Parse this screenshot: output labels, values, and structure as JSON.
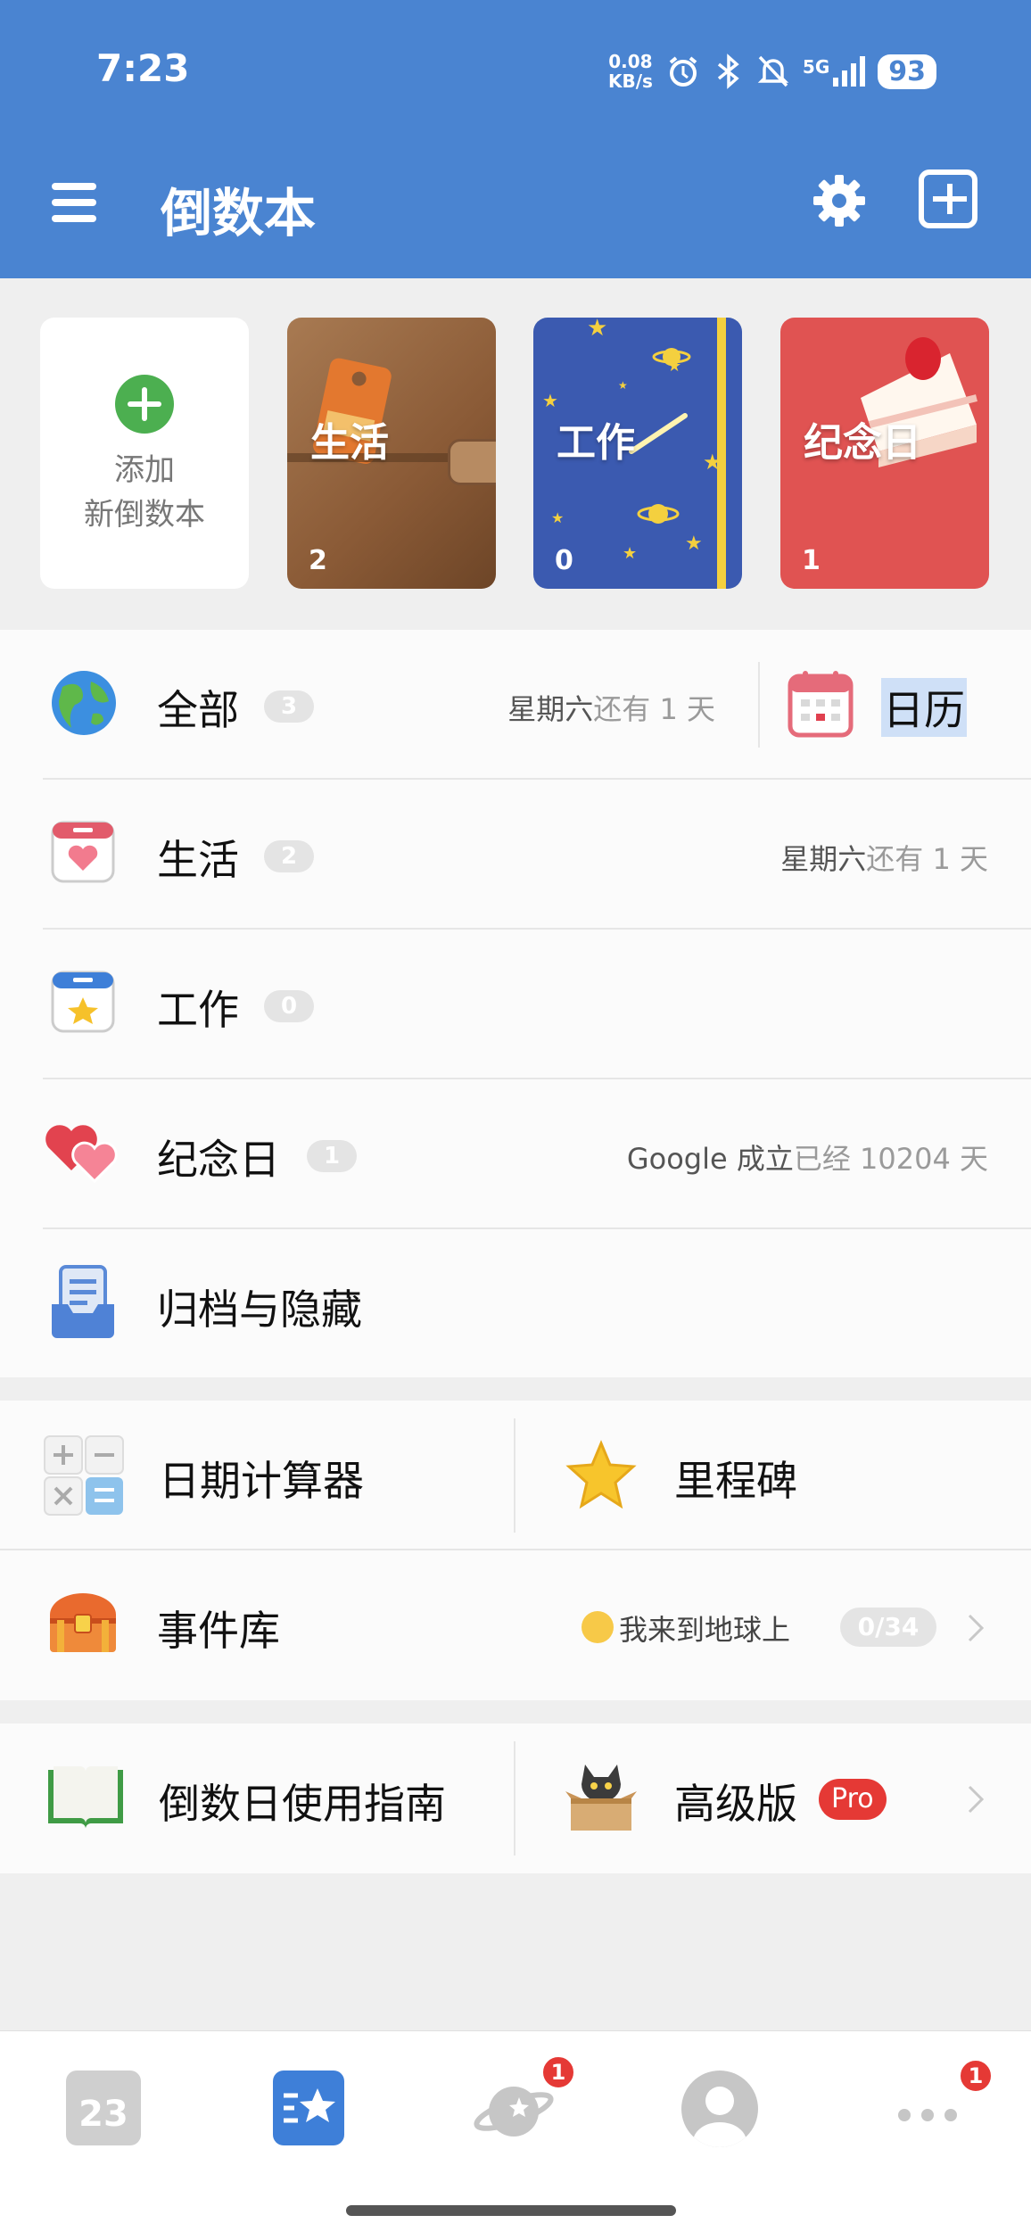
{
  "status_bar": {
    "time": "7:23",
    "net_speed_value": "0.08",
    "net_speed_unit": "KB/s",
    "network": "5G",
    "battery": "93"
  },
  "app_bar": {
    "title": "倒数本"
  },
  "books": {
    "add_line1": "添加",
    "add_line2": "新倒数本",
    "items": [
      {
        "name": "生活",
        "count": "2"
      },
      {
        "name": "工作",
        "count": "0"
      },
      {
        "name": "纪念日",
        "count": "1"
      }
    ]
  },
  "categories": {
    "all": {
      "label": "全部",
      "count": "3",
      "event": "星期六",
      "suffix": "还有 1 天"
    },
    "calendar_label": "日历",
    "life": {
      "label": "生活",
      "count": "2",
      "event": "星期六",
      "suffix": "还有 1 天"
    },
    "work": {
      "label": "工作",
      "count": "0"
    },
    "anniversary": {
      "label": "纪念日",
      "count": "1",
      "event": "Google 成立",
      "suffix": "已经 10204 天"
    },
    "archive": {
      "label": "归档与隐藏"
    }
  },
  "tools": {
    "date_calculator": "日期计算器",
    "milestone": "里程碑",
    "event_library": "事件库",
    "event_library_hint": "我来到地球上",
    "event_library_progress": "0/34",
    "guide": "倒数日使用指南",
    "premium": "高级版",
    "pro_badge": "Pro"
  },
  "bottom_nav": {
    "calendar_day": "23",
    "planet_badge": "1",
    "more_badge": "1"
  },
  "colors": {
    "app_bar": "#4a84d1",
    "accent_green": "#4caf50",
    "badge_red": "#e53935",
    "anniversary_red": "#e05352",
    "work_blue": "#3b5ab0"
  },
  "icons": [
    "menu-icon",
    "gear-icon",
    "add-book-icon",
    "globe-icon",
    "calendar-icon",
    "heart-calendar-icon",
    "star-calendar-icon",
    "hearts-icon",
    "archive-icon",
    "calculator-icon",
    "star-icon",
    "treasure-chest-icon",
    "book-icon",
    "cat-box-icon",
    "chevron-right-icon",
    "planet-icon",
    "profile-icon",
    "more-icon"
  ]
}
